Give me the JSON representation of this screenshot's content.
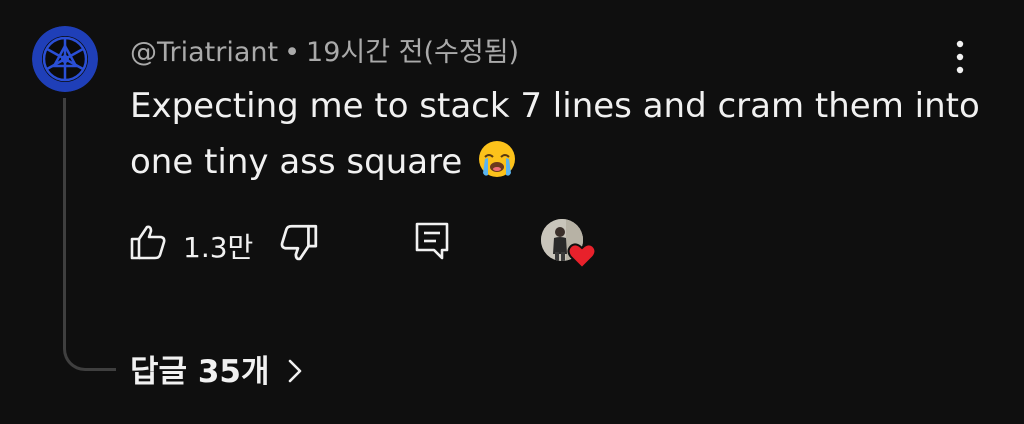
{
  "comment": {
    "author": "@Triatriant",
    "separator": "•",
    "timestamp": "19시간 전(수정됨)",
    "text_line1": "Expecting me to stack 7 lines and cram them into",
    "text_line2": "one tiny ass square",
    "emoji": "loudly-crying-face",
    "like_count": "1.3만",
    "replies_label": "답글 35개"
  },
  "icons": {
    "like": "thumbs-up-icon",
    "dislike": "thumbs-down-icon",
    "reply": "reply-icon",
    "menu": "more-vertical-icon",
    "creator_heart": "creator-heart-icon",
    "replies_chevron": "chevron-right-icon"
  },
  "colors": {
    "background": "#0f0f0f",
    "text_primary": "#f1f1f1",
    "text_secondary": "#aaaaaa",
    "heart": "#e8212b",
    "avatar_blue": "#1f3fb8"
  }
}
